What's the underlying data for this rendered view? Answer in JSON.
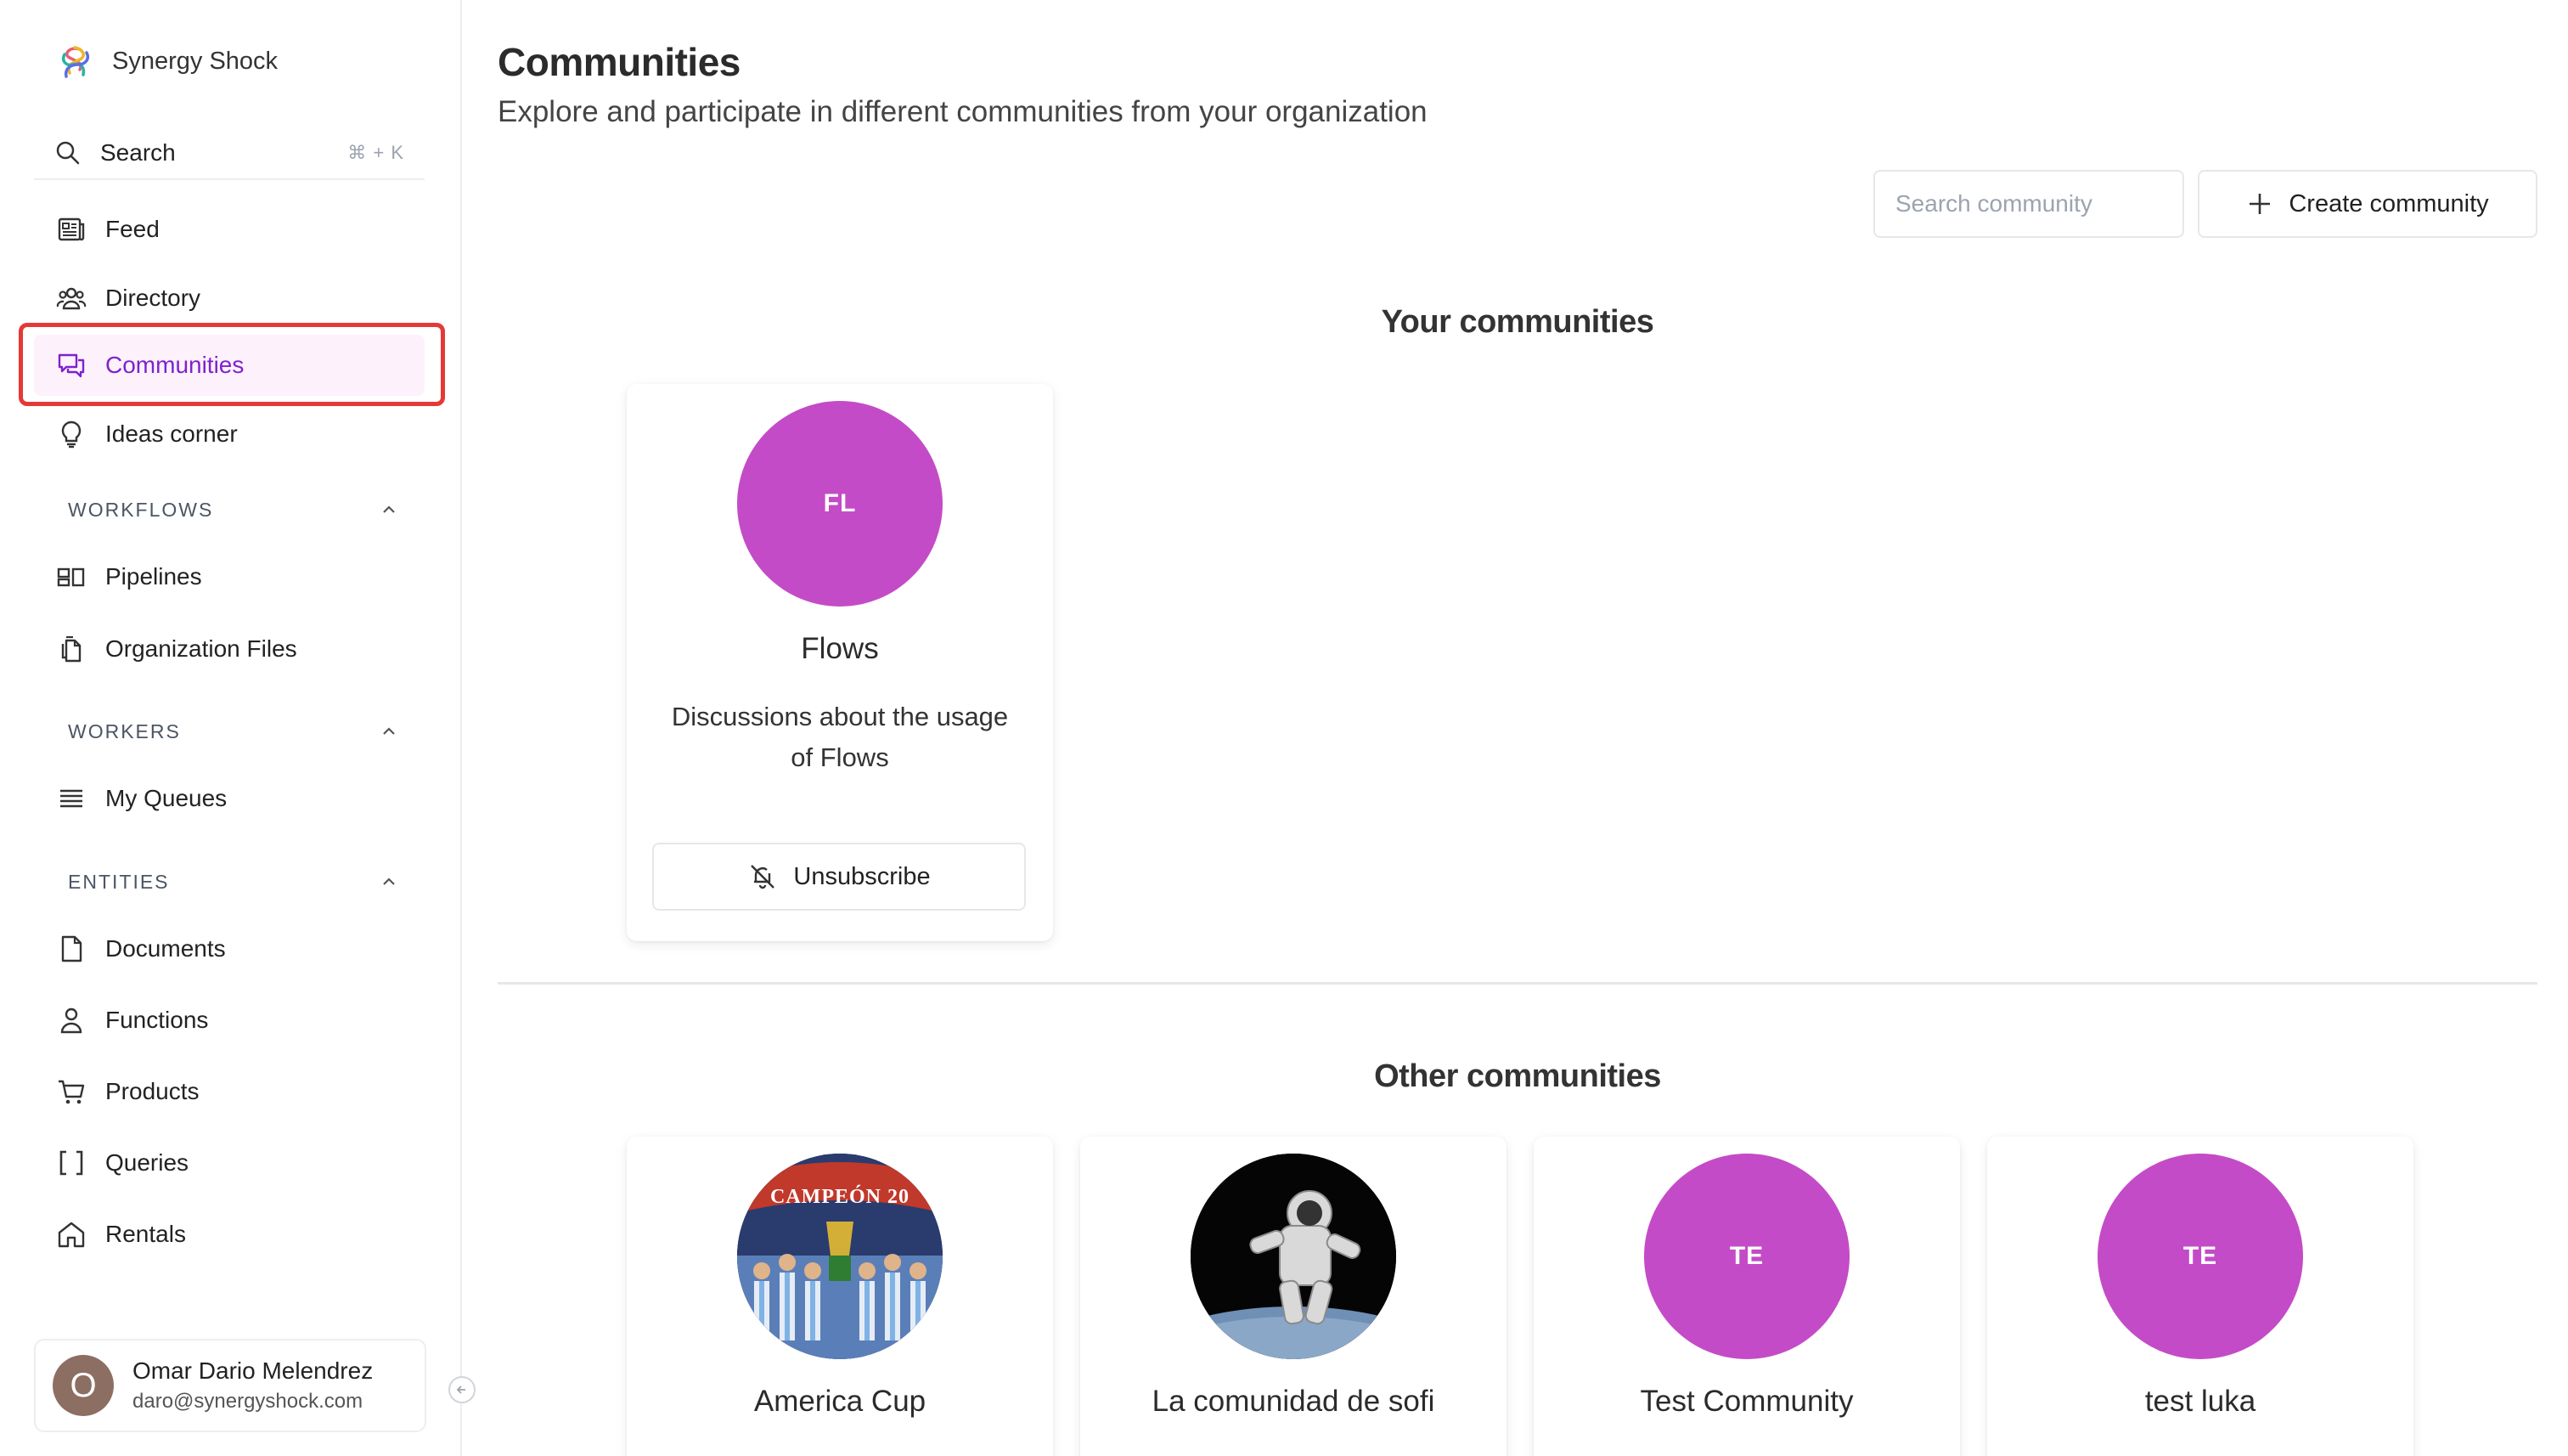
{
  "app": {
    "name": "Synergy Shock"
  },
  "sidebar": {
    "search": {
      "label": "Search",
      "shortcut": "⌘ + K"
    },
    "primary": [
      {
        "label": "Feed",
        "icon": "feed-icon"
      },
      {
        "label": "Directory",
        "icon": "users-icon"
      },
      {
        "label": "Communities",
        "icon": "chat-bubbles-icon",
        "active": true
      },
      {
        "label": "Ideas corner",
        "icon": "lightbulb-icon"
      }
    ],
    "sections": [
      {
        "title": "WORKFLOWS",
        "items": [
          {
            "label": "Pipelines",
            "icon": "pipeline-icon"
          },
          {
            "label": "Organization Files",
            "icon": "files-icon"
          }
        ]
      },
      {
        "title": "WORKERS",
        "items": [
          {
            "label": "My Queues",
            "icon": "queue-list-icon"
          }
        ]
      },
      {
        "title": "ENTITIES",
        "items": [
          {
            "label": "Documents",
            "icon": "document-icon"
          },
          {
            "label": "Functions",
            "icon": "person-icon"
          },
          {
            "label": "Products",
            "icon": "cart-icon"
          },
          {
            "label": "Queries",
            "icon": "brackets-icon"
          },
          {
            "label": "Rentals",
            "icon": "home-icon"
          }
        ]
      }
    ],
    "user": {
      "initial": "O",
      "name": "Omar Dario Melendrez",
      "email": "daro@synergyshock.com"
    }
  },
  "page": {
    "title": "Communities",
    "subtitle": "Explore and participate in different communities from your organization",
    "search_placeholder": "Search community",
    "create_label": "Create community"
  },
  "your_communities": {
    "title": "Your communities",
    "items": [
      {
        "initials": "FL",
        "name": "Flows",
        "description": "Discussions about the usage of Flows",
        "action": "Unsubscribe",
        "color": "#c44bc7"
      }
    ]
  },
  "other_communities": {
    "title": "Other communities",
    "items": [
      {
        "name": "America Cup",
        "image": "trophy-photo",
        "photo_text": "CAMPEÓN 20"
      },
      {
        "name": "La comunidad de sofi",
        "image": "astronaut-photo"
      },
      {
        "initials": "TE",
        "name": "Test Community",
        "color": "#c44bc7"
      },
      {
        "initials": "TE",
        "name": "test luka",
        "color": "#c44bc7"
      }
    ]
  },
  "colors": {
    "accent": "#7e22ce",
    "community_purple": "#c44bc7",
    "highlight": "#e53935"
  }
}
